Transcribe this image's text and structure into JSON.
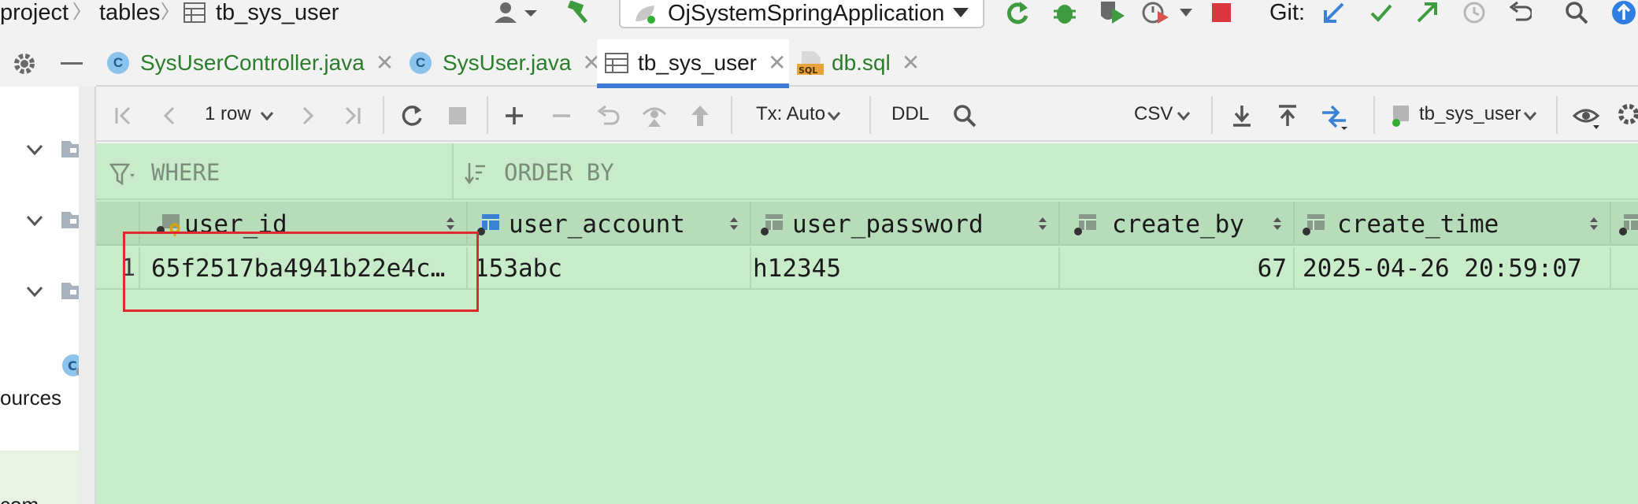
{
  "breadcrumb": {
    "items": [
      "project",
      "tables",
      "tb_sys_user"
    ]
  },
  "toolbar": {
    "run_config": "OjSystemSpringApplication",
    "git_label": "Git:"
  },
  "left_panel": {
    "partial_labels": [
      "ources",
      "com"
    ]
  },
  "tabs": [
    {
      "label": "SysUserController.java",
      "icon": "class-icon",
      "active": false,
      "color": "#2a7d2a"
    },
    {
      "label": "SysUser.java",
      "icon": "class-icon",
      "active": false,
      "color": "#2a7d2a"
    },
    {
      "label": "tb_sys_user",
      "icon": "table-icon",
      "active": true,
      "color": "#1a1a1a"
    },
    {
      "label": "db.sql",
      "icon": "sql-file-icon",
      "active": false,
      "color": "#2a7d2a"
    }
  ],
  "grid_toolbar": {
    "row_count": "1 row",
    "tx_mode": "Tx: Auto",
    "ddl": "DDL",
    "export_format": "CSV",
    "datasource": "tb_sys_user"
  },
  "filters": {
    "where": "WHERE",
    "order_by": "ORDER BY"
  },
  "table": {
    "columns": [
      "user_id",
      "user_account",
      "user_password",
      "create_by",
      "create_time"
    ],
    "rows": [
      {
        "num": "1",
        "user_id": "65f2517ba4941b22e4c…",
        "user_account": "153abc",
        "user_password": "h12345",
        "create_by": "67",
        "create_time": "2025-04-26 20:59:07"
      }
    ]
  },
  "colors": {
    "results_bg": "#c8ecca",
    "accent": "#3d7bd4",
    "highlight": "#e0282e"
  }
}
